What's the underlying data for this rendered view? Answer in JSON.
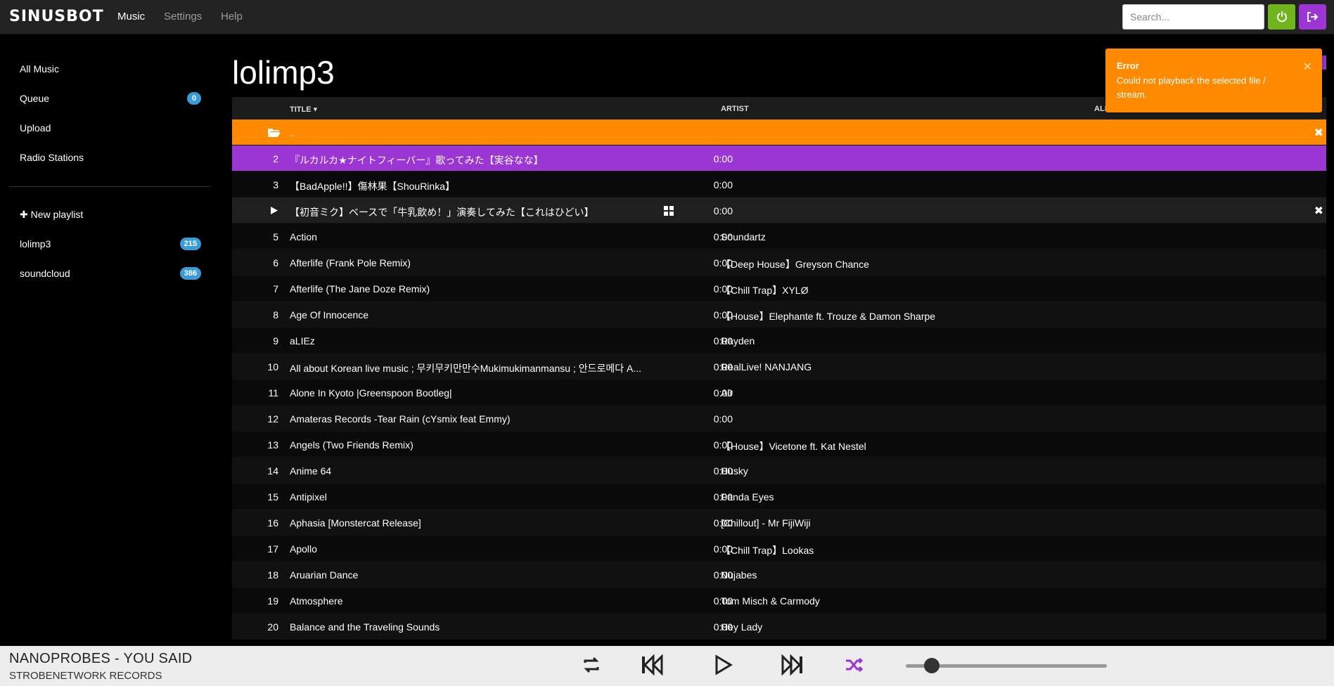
{
  "app": {
    "logo": "SINUSBOT",
    "nav": [
      {
        "label": "Music",
        "active": true
      },
      {
        "label": "Settings",
        "active": false
      },
      {
        "label": "Help",
        "active": false
      }
    ],
    "search_placeholder": "Search..."
  },
  "sidebar": {
    "items": [
      {
        "label": "All Music"
      },
      {
        "label": "Queue",
        "badge": "0"
      },
      {
        "label": "Upload"
      },
      {
        "label": "Radio Stations"
      }
    ],
    "new_playlist": "New playlist",
    "playlists": [
      {
        "label": "lolimp3",
        "badge": "215"
      },
      {
        "label": "soundcloud",
        "badge": "386"
      }
    ]
  },
  "main": {
    "title": "lolimp3",
    "columns": {
      "title": "TITLE",
      "artist": "ARTIST",
      "album": "ALBUM"
    },
    "folder_row": "..",
    "rows": [
      {
        "num": "2",
        "title": "『ルカルカ★ナイトフィーバー』歌ってみた【実谷なな】",
        "duration": "0:00",
        "artist": ""
      },
      {
        "num": "3",
        "title": "【BadApple!!】傷林果【ShouRinka】",
        "duration": "0:00",
        "artist": ""
      },
      {
        "num": "",
        "title": "【初音ミク】ベースで「牛乳飲め！」演奏してみた【これはひどい】",
        "duration": "0:00",
        "artist": ""
      },
      {
        "num": "5",
        "title": "Action",
        "duration": "0:00",
        "artist": "Soundartz"
      },
      {
        "num": "6",
        "title": "Afterlife (Frank Pole Remix)",
        "duration": "0:00",
        "artist": "【Deep House】Greyson Chance"
      },
      {
        "num": "7",
        "title": "Afterlife (The Jane Doze Remix)",
        "duration": "0:00",
        "artist": "【Chill Trap】XYLØ"
      },
      {
        "num": "8",
        "title": "Age Of Innocence",
        "duration": "0:00",
        "artist": "【House】Elephante ft. Trouze & Damon Sharpe"
      },
      {
        "num": "9",
        "title": "aLIEz",
        "duration": "0:00",
        "artist": "Rayden"
      },
      {
        "num": "10",
        "title": "All about Korean live music ; 무키무키만만수Mukimukimanmansu ; 안드로메다 A...",
        "duration": "0:00",
        "artist": "RealLive! NANJANG"
      },
      {
        "num": "11",
        "title": "Alone In Kyoto |Greenspoon Bootleg|",
        "duration": "0:00",
        "artist": "Air"
      },
      {
        "num": "12",
        "title": "Amateras Records -Tear Rain (cYsmix feat Emmy)",
        "duration": "0:00",
        "artist": ""
      },
      {
        "num": "13",
        "title": "Angels (Two Friends Remix)",
        "duration": "0:00",
        "artist": "【House】Vicetone ft. Kat Nestel"
      },
      {
        "num": "14",
        "title": "Anime 64",
        "duration": "0:00",
        "artist": "Husky"
      },
      {
        "num": "15",
        "title": "Antipixel",
        "duration": "0:00",
        "artist": "Panda Eyes"
      },
      {
        "num": "16",
        "title": "Aphasia [Monstercat Release]",
        "duration": "0:00",
        "artist": "[Chillout] - Mr FijiWiji"
      },
      {
        "num": "17",
        "title": "Apollo",
        "duration": "0:00",
        "artist": "【Chill Trap】Lookas"
      },
      {
        "num": "18",
        "title": "Aruarian Dance",
        "duration": "0:00",
        "artist": "Nujabes"
      },
      {
        "num": "19",
        "title": "Atmosphere",
        "duration": "0:00",
        "artist": "Tom Misch & Carmody"
      },
      {
        "num": "20",
        "title": "Balance and the Traveling Sounds",
        "duration": "0:00",
        "artist": "Hey Lady"
      }
    ]
  },
  "toast": {
    "title": "Error",
    "message": "Could not playback the selected file / stream.",
    "color": "#ff8a00"
  },
  "player": {
    "track": "NANOPROBES - YOU SAID",
    "artist": "STROBENETWORK RECORDS",
    "volume": 0.13,
    "shuffle_color": "#9b36d4"
  },
  "colors": {
    "accent_purple": "#9b36d4",
    "accent_orange": "#ff8a00",
    "power_green": "#6fb51b",
    "badge_blue": "#3a9bd9"
  }
}
